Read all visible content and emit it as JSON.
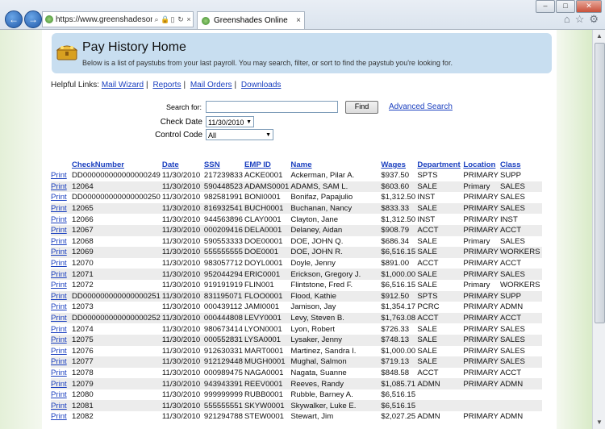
{
  "browser": {
    "url": "https://www.greenshadesonl...",
    "tab_title": "Greenshades Online",
    "back_label": "←",
    "forward_label": "→"
  },
  "page": {
    "title": "Pay History Home",
    "subtitle": "Below is a list of paystubs from your last payroll. You may search, filter, or sort to find the paystub you're looking for.",
    "helpful_label": "Helpful Links:",
    "links": [
      "Mail Wizard",
      "Reports",
      "Mail Orders",
      "Downloads"
    ],
    "search_label": "Search for:",
    "search_value": "",
    "find_label": "Find",
    "advanced_search": "Advanced Search",
    "check_date_label": "Check Date",
    "check_date_value": "11/30/2010",
    "control_code_label": "Control Code",
    "control_code_value": "All"
  },
  "table": {
    "columns": [
      "CheckNumber",
      "Date",
      "SSN",
      "EMP ID",
      "Name",
      "Wages",
      "Department",
      "Location",
      "Class"
    ],
    "print_label": "Print",
    "rows": [
      [
        "DD000000000000000249",
        "11/30/2010",
        "217239833",
        "ACKE0001",
        "Ackerman, Pilar A.",
        "$937.50",
        "SPTS",
        "PRIMARY",
        "SUPP"
      ],
      [
        "12064",
        "11/30/2010",
        "590448523",
        "ADAMS0001",
        "ADAMS, SAM L.",
        "$603.60",
        "SALE",
        "Primary",
        "SALES"
      ],
      [
        "DD000000000000000250",
        "11/30/2010",
        "982581991",
        "BONI0001",
        "Bonifaz, Papajulio",
        "$1,312.50",
        "INST",
        "PRIMARY",
        "SALES"
      ],
      [
        "12065",
        "11/30/2010",
        "816932541",
        "BUCH0001",
        "Buchanan, Nancy",
        "$833.33",
        "SALE",
        "PRIMARY",
        "SALES"
      ],
      [
        "12066",
        "11/30/2010",
        "944563896",
        "CLAY0001",
        "Clayton, Jane",
        "$1,312.50",
        "INST",
        "PRIMARY",
        "INST"
      ],
      [
        "12067",
        "11/30/2010",
        "000209416",
        "DELA0001",
        "Delaney, Aidan",
        "$908.79",
        "ACCT",
        "PRIMARY",
        "ACCT"
      ],
      [
        "12068",
        "11/30/2010",
        "590553333",
        "DOE00001",
        "DOE, JOHN Q.",
        "$686.34",
        "SALE",
        "Primary",
        "SALES"
      ],
      [
        "12069",
        "11/30/2010",
        "555555555",
        "DOE0001",
        "DOE, JOHN R.",
        "$6,516.15",
        "SALE",
        "PRIMARY",
        "WORKERS"
      ],
      [
        "12070",
        "11/30/2010",
        "983057712",
        "DOYL0001",
        "Doyle, Jenny",
        "$891.00",
        "ACCT",
        "PRIMARY",
        "ACCT"
      ],
      [
        "12071",
        "11/30/2010",
        "952044294",
        "ERIC0001",
        "Erickson, Gregory J.",
        "$1,000.00",
        "SALE",
        "PRIMARY",
        "SALES"
      ],
      [
        "12072",
        "11/30/2010",
        "919191919",
        "FLIN001",
        "Flintstone, Fred F.",
        "$6,516.15",
        "SALE",
        "Primary",
        "WORKERS"
      ],
      [
        "DD000000000000000251",
        "11/30/2010",
        "831195071",
        "FLOO0001",
        "Flood, Kathie",
        "$912.50",
        "SPTS",
        "PRIMARY",
        "SUPP"
      ],
      [
        "12073",
        "11/30/2010",
        "000439112",
        "JAMI0001",
        "Jamison, Jay",
        "$1,354.17",
        "PCRC",
        "PRIMARY",
        "ADMN"
      ],
      [
        "DD000000000000000252",
        "11/30/2010",
        "000444808",
        "LEVY0001",
        "Levy, Steven B.",
        "$1,763.08",
        "ACCT",
        "PRIMARY",
        "ACCT"
      ],
      [
        "12074",
        "11/30/2010",
        "980673414",
        "LYON0001",
        "Lyon, Robert",
        "$726.33",
        "SALE",
        "PRIMARY",
        "SALES"
      ],
      [
        "12075",
        "11/30/2010",
        "000552831",
        "LYSA0001",
        "Lysaker, Jenny",
        "$748.13",
        "SALE",
        "PRIMARY",
        "SALES"
      ],
      [
        "12076",
        "11/30/2010",
        "912630331",
        "MART0001",
        "Martinez, Sandra I.",
        "$1,000.00",
        "SALE",
        "PRIMARY",
        "SALES"
      ],
      [
        "12077",
        "11/30/2010",
        "912129448",
        "MUGH0001",
        "Mughal, Salmon",
        "$719.13",
        "SALE",
        "PRIMARY",
        "SALES"
      ],
      [
        "12078",
        "11/30/2010",
        "000989475",
        "NAGA0001",
        "Nagata, Suanne",
        "$848.58",
        "ACCT",
        "PRIMARY",
        "ACCT"
      ],
      [
        "12079",
        "11/30/2010",
        "943943391",
        "REEV0001",
        "Reeves, Randy",
        "$1,085.71",
        "ADMN",
        "PRIMARY",
        "ADMN"
      ],
      [
        "12080",
        "11/30/2010",
        "999999999",
        "RUBB0001",
        "Rubble, Barney A.",
        "$6,516.15",
        "",
        "",
        ""
      ],
      [
        "12081",
        "11/30/2010",
        "555555551",
        "SKYW0001",
        "Skywalker, Luke E.",
        "$6,516.15",
        "",
        "",
        ""
      ],
      [
        "12082",
        "11/30/2010",
        "921294788",
        "STEW0001",
        "Stewart, Jim",
        "$2,027.25",
        "ADMN",
        "PRIMARY",
        "ADMN"
      ]
    ]
  }
}
